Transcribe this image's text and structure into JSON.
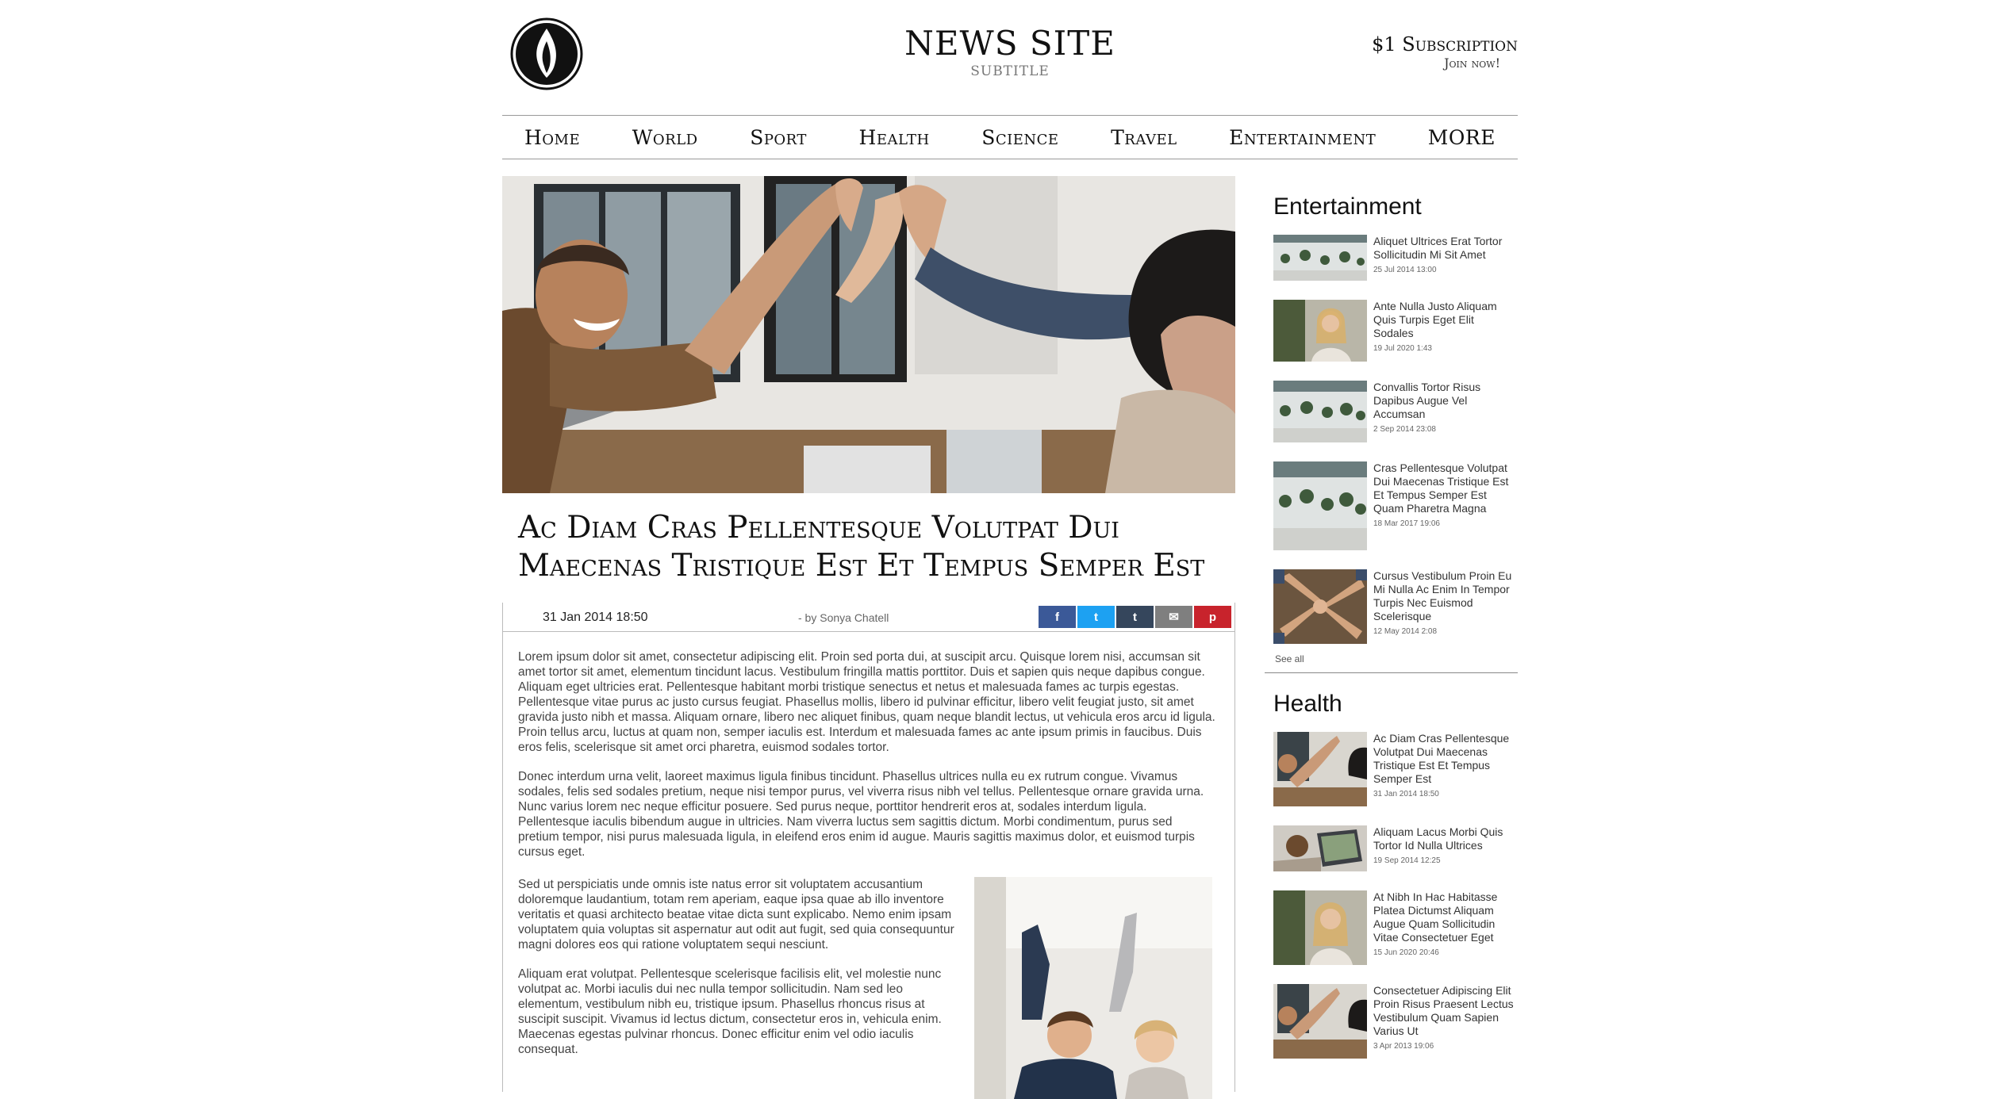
{
  "header": {
    "title": "NEWS SITE",
    "subtitle": "SUBTITLE",
    "subscription": "$1 Subscription",
    "join": "Join now!"
  },
  "nav": [
    "Home",
    "World",
    "Sport",
    "Health",
    "Science",
    "Travel",
    "Entertainment",
    "MORE"
  ],
  "article": {
    "headline": "Ac Diam Cras Pellentesque Volutpat Dui Maecenas Tristique Est Et Tempus Semper Est",
    "date": "31 Jan 2014 18:50",
    "author": "- by Sonya Chatell",
    "share": [
      {
        "icon": "facebook-icon",
        "glyph": "f",
        "color": "#3b5998"
      },
      {
        "icon": "twitter-icon",
        "glyph": "t",
        "color": "#1da1f2"
      },
      {
        "icon": "tumblr-icon",
        "glyph": "t",
        "color": "#35465c"
      },
      {
        "icon": "email-icon",
        "glyph": "✉",
        "color": "#7f7f7f"
      },
      {
        "icon": "pinterest-icon",
        "glyph": "p",
        "color": "#c8232c"
      }
    ],
    "paragraphs": [
      "Lorem ipsum dolor sit amet, consectetur adipiscing elit. Proin sed porta dui, at suscipit arcu. Quisque lorem nisi, accumsan sit amet tortor sit amet, elementum tincidunt lacus. Vestibulum fringilla mattis porttitor. Duis et sapien quis neque dapibus congue. Aliquam eget ultricies erat. Pellentesque habitant morbi tristique senectus et netus et malesuada fames ac turpis egestas. Pellentesque vitae purus ac justo cursus feugiat. Phasellus mollis, libero id pulvinar efficitur, libero velit feugiat justo, sit amet gravida justo nibh et massa. Aliquam ornare, libero nec aliquet finibus, quam neque blandit lectus, ut vehicula eros arcu id ligula. Proin tellus arcu, luctus at quam non, semper iaculis est. Interdum et malesuada fames ac ante ipsum primis in faucibus. Duis eros felis, scelerisque sit amet orci pharetra, euismod sodales tortor.",
      "Donec interdum urna velit, laoreet maximus ligula finibus tincidunt. Phasellus ultrices nulla eu ex rutrum congue. Vivamus sodales, felis sed sodales pretium, neque nisi tempor purus, vel viverra risus nibh vel tellus. Pellentesque ornare gravida urna. Nunc varius lorem nec neque efficitur posuere. Sed purus neque, porttitor hendrerit eros at, sodales interdum ligula. Pellentesque iaculis bibendum augue in ultricies. Nam viverra luctus sem sagittis dictum. Morbi condimentum, purus sed pretium tempor, nisi purus malesuada ligula, in eleifend eros enim id augue. Mauris sagittis maximus dolor, et euismod turpis cursus eget.",
      "Sed ut perspiciatis unde omnis iste natus error sit voluptatem accusantium doloremque laudantium, totam rem aperiam, eaque ipsa quae ab illo inventore veritatis et quasi architecto beatae vitae dicta sunt explicabo. Nemo enim ipsam voluptatem quia voluptas sit aspernatur aut odit aut fugit, sed quia consequuntur magni dolores eos qui ratione voluptatem sequi nesciunt.",
      "Aliquam erat volutpat. Pellentesque scelerisque facilisis elit, vel molestie nunc volutpat ac. Morbi iaculis dui nec nulla tempor sollicitudin. Nam sed leo elementum, vestibulum nibh eu, tristique ipsum. Phasellus rhoncus risus at suscipit suscipit. Vivamus id lectus dictum, consectetur eros in, vehicula enim. Maecenas egestas pulvinar rhoncus. Donec efficitur enim vel odio iaculis consequat."
    ]
  },
  "sidebar": {
    "entertainment": {
      "heading": "Entertainment",
      "see_all": "See all",
      "items": [
        {
          "title": "Aliquet Ultrices Erat Tortor Sollicitudin Mi Sit Amet",
          "date": "25 Jul 2014 13:00",
          "thumb": "plants"
        },
        {
          "title": "Ante Nulla Justo Aliquam Quis Turpis Eget Elit Sodales",
          "date": "19 Jul 2020 1:43",
          "thumb": "woman"
        },
        {
          "title": "Convallis Tortor Risus Dapibus Augue Vel Accumsan",
          "date": "2 Sep 2014 23:08",
          "thumb": "plants"
        },
        {
          "title": "Cras Pellentesque Volutpat Dui Maecenas Tristique Est Et Tempus Semper Est Quam Pharetra Magna",
          "date": "18 Mar 2017 19:06",
          "thumb": "plants"
        },
        {
          "title": "Cursus Vestibulum Proin Eu Mi Nulla Ac Enim In Tempor Turpis Nec Euismod Scelerisque",
          "date": "12 May 2014 2:08",
          "thumb": "hands"
        }
      ]
    },
    "health": {
      "heading": "Health",
      "items": [
        {
          "title": "Ac Diam Cras Pellentesque Volutpat Dui Maecenas Tristique Est Et Tempus Semper Est",
          "date": "31 Jan 2014 18:50",
          "thumb": "highfive"
        },
        {
          "title": "Aliquam Lacus Morbi Quis Tortor Id Nulla Ultrices",
          "date": "19 Sep 2014 12:25",
          "thumb": "laptop"
        },
        {
          "title": "At Nibh In Hac Habitasse Platea Dictumst Aliquam Augue Quam Sollicitudin Vitae Consectetuer Eget",
          "date": "15 Jun 2020 20:46",
          "thumb": "woman"
        },
        {
          "title": "Consectetuer Adipiscing Elit Proin Risus Praesent Lectus Vestibulum Quam Sapien Varius Ut",
          "date": "3 Apr 2013 19:06",
          "thumb": "highfive"
        }
      ]
    }
  }
}
